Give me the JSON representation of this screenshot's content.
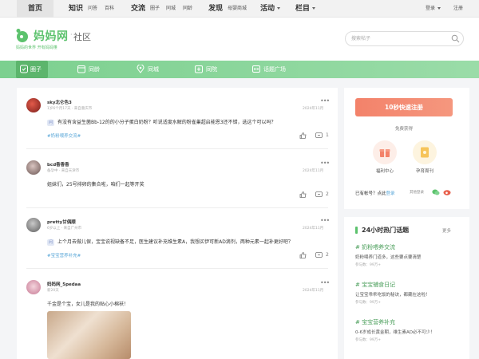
{
  "topbar": {
    "home": "首页",
    "zhishi": "知识",
    "wenda": "问答",
    "baike": "百科",
    "jiaoliu": "交流",
    "quanzi": "圈子",
    "tongcheng": "同城",
    "tongling": "同龄",
    "faxian": "发现",
    "muying": "母婴商城",
    "huodong": "活动",
    "lanmu": "栏目",
    "login": "登录",
    "register": "注册"
  },
  "header": {
    "logo": "妈妈网",
    "sep": "·",
    "subtitle": "社区",
    "slogan": "妈妈的世界  开有妈妈懂",
    "search_placeholder": "搜索帖子"
  },
  "nav": [
    {
      "label": "圈子",
      "icon": "circle-icon"
    },
    {
      "label": "同龄",
      "icon": "calendar-icon"
    },
    {
      "label": "同城",
      "icon": "location-icon"
    },
    {
      "label": "同院",
      "icon": "hospital-icon"
    },
    {
      "label": "话题广场",
      "icon": "topic-icon"
    }
  ],
  "posts": [
    {
      "user": "sky北仑色3",
      "meta": "1岁6个月17天 · 来自重庆市",
      "date": "2024年11月",
      "text": "有没有含益生菌Bb-12的的小分子蛋白奶粉？听说适度水解的粉雀巢超启能恩3还不错，选这个可以吗？",
      "tag": "#奶粉喂养交流#",
      "likes": "",
      "comments": "1"
    },
    {
      "user": "bcd香香香",
      "meta": "备孕中 · 来自天津市",
      "date": "2024年11月",
      "text": "姐妹们，25号排卵的集合啦，咱们一起等开奖",
      "tag": "",
      "likes": "",
      "comments": "2"
    },
    {
      "user": "pretty甘偶顺",
      "meta": "6岁以上 · 来自广州市",
      "date": "2024年11月",
      "text": "上个月去做儿保，宝宝说视缺备不足，医生建议补充维生素A，我想买伊可新AD滴剂，两种元素一起补更好吧？",
      "tag": "#宝宝营养补充#",
      "likes": "",
      "comments": "2"
    },
    {
      "user": "妈妈网_5pedaa",
      "meta": "新20天",
      "date": "2024年11月",
      "text": "千金是个宝，女儿是我的贴心小棉袄！",
      "tag": "",
      "likes": "",
      "comments": ""
    }
  ],
  "sidebar": {
    "register_button": "10秒快速注册",
    "free_get": "免费获得",
    "gift1": "福利中心",
    "gift2": "孕育周刊",
    "have_account": "已有帐号？点此",
    "login_link": "登录",
    "quick_login": "其他登录"
  },
  "hot": {
    "title": "24小时热门话题",
    "more": "更多",
    "topics": [
      {
        "title": "# 奶粉喂养交流",
        "desc": "奶粉喂养门道多，这些要点要清楚",
        "count": "参与数：99万+"
      },
      {
        "title": "# 宝宝辅食日记",
        "desc": "让宝宝乖乖吃饭的秘诀，都藏在这啦！",
        "count": "参与数：99万+"
      },
      {
        "title": "# 宝宝营养补充",
        "desc": "0-6岁成长黄金期，维生素AD必不可少！",
        "count": "参与数：99万+"
      }
    ]
  },
  "colors": {
    "brand_green": "#5cc26d",
    "nav_green": "#7cd08f",
    "register_orange": "#f3826a",
    "tag_blue": "#5aa7d8"
  }
}
